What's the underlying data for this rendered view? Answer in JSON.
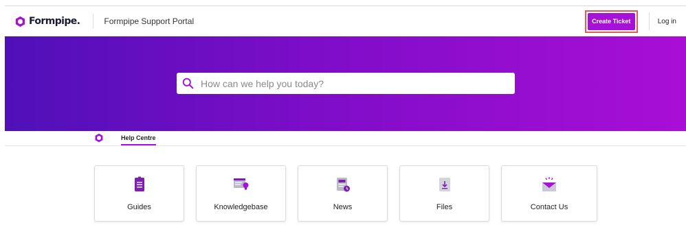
{
  "header": {
    "brand": "Formpipe.",
    "portal_title": "Formpipe Support Portal",
    "create_ticket_label": "Create Ticket",
    "login_label": "Log in"
  },
  "hero": {
    "search_placeholder": "How can we help you today?"
  },
  "subnav": {
    "tab_label": "Help Centre"
  },
  "cards": [
    {
      "label": "Guides",
      "icon": "guides-document-icon"
    },
    {
      "label": "Knowledgebase",
      "icon": "knowledgebase-lightbulb-icon"
    },
    {
      "label": "News",
      "icon": "news-clock-icon"
    },
    {
      "label": "Files",
      "icon": "files-download-icon"
    },
    {
      "label": "Contact Us",
      "icon": "contact-envelope-icon"
    }
  ],
  "colors": {
    "accent": "#a511d6",
    "hero_start": "#4f10b8",
    "hero_end": "#a90ed6",
    "highlight_border": "#e05a5a"
  }
}
